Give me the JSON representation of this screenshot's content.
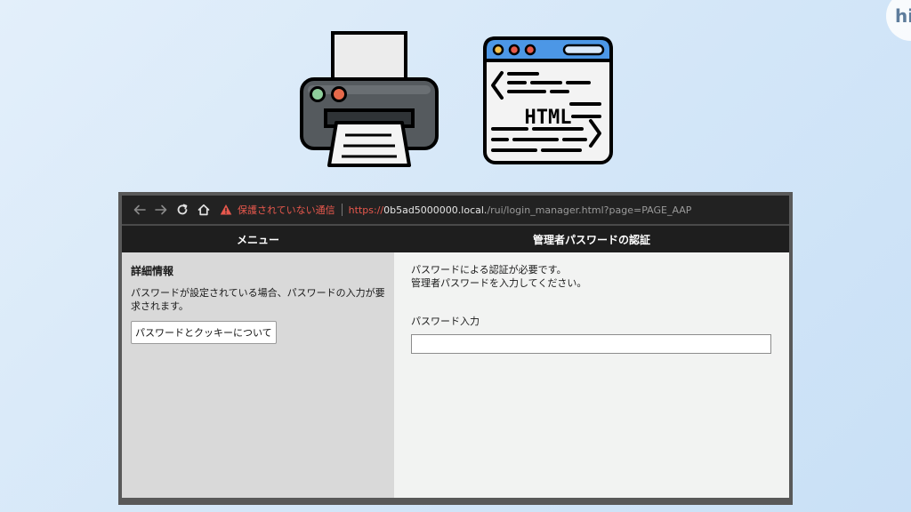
{
  "corner_logo": {
    "text": "hi"
  },
  "illustrations": [
    {
      "name": "printer-illustration",
      "icon": "printer-icon"
    },
    {
      "name": "html-page-illustration",
      "icon": "html-document-icon",
      "label": "HTML"
    }
  ],
  "browser": {
    "nav_icons": [
      "back-arrow-icon",
      "forward-arrow-icon",
      "reload-icon",
      "home-icon"
    ],
    "security_warning": "保護されていない通信",
    "url_scheme": "https://",
    "url_host": "0b5ad5000000.local.",
    "url_path": "/rui/login_manager.html?page=PAGE_AAP",
    "colors": {
      "warning": "#e8584d",
      "chrome_dark": "#222222"
    }
  },
  "sidebar": {
    "header": "メニュー",
    "section_title": "詳細情報",
    "description": "パスワードが設定されている場合、パスワードの入力が要求されます。",
    "about_button": "パスワードとクッキーについて"
  },
  "main": {
    "header": "管理者パスワードの認証",
    "message_line1": "パスワードによる認証が必要です。",
    "message_line2": "管理者パスワードを入力してください。",
    "password_label": "パスワード入力",
    "password_value": ""
  }
}
